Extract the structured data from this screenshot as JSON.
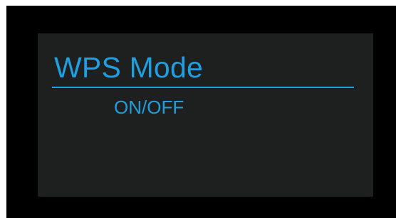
{
  "screen": {
    "title": "WPS Mode",
    "option_label": "ON/OFF"
  },
  "colors": {
    "accent": "#1f9fe0",
    "screen_background": "#1e1f1f",
    "bezel": "#000000"
  }
}
